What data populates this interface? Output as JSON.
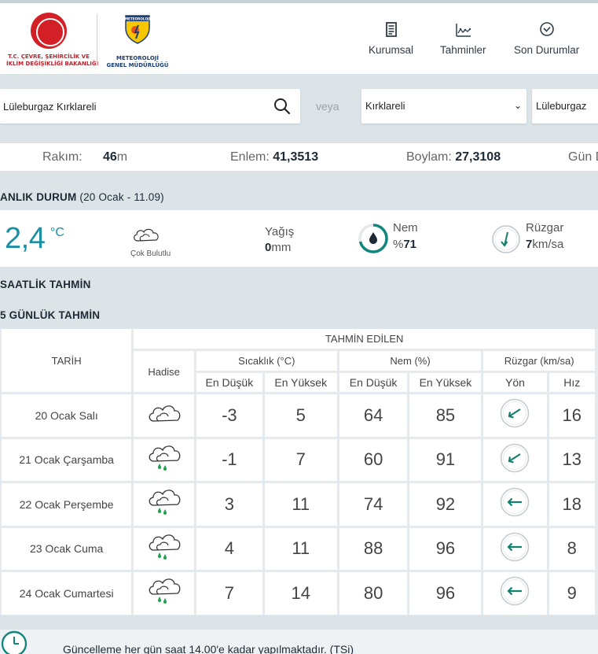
{
  "header": {
    "logo1_line1": "T.C. ÇEVRE, ŞEHİRCİLİK VE",
    "logo1_line2": "İKLİM DEĞİŞİKLİĞİ BAKANLIĞI",
    "logo2_badge": "METEOROLOJİ",
    "logo2_line1": "METEOROLOJİ",
    "logo2_line2": "GENEL MÜDÜRLÜĞÜ",
    "nav": [
      {
        "label": "Kurumsal",
        "icon": "document-icon"
      },
      {
        "label": "Tahminler",
        "icon": "chart-icon"
      },
      {
        "label": "Son Durumlar",
        "icon": "check-circle-icon"
      }
    ]
  },
  "search": {
    "value": "Lüleburgaz Kırklareli",
    "or_label": "veya",
    "province": "Kırklareli",
    "district": "Lüleburgaz"
  },
  "info": {
    "altitude_label": "Rakım:",
    "altitude_value": "46",
    "altitude_unit": "m",
    "lat_label": "Enlem:",
    "lat_value": "41,3513",
    "lon_label": "Boylam:",
    "lon_value": "27,3108",
    "extra_label": "Gün D"
  },
  "current": {
    "title": "ANLIK DURUM",
    "time": "(20 Ocak - 11.09)",
    "temp": "2,4",
    "temp_unit": "°C",
    "condition": "Çok Bulutlu",
    "rain_label": "Yağış",
    "rain_value": "0",
    "rain_unit": "mm",
    "humidity_label": "Nem",
    "humidity_prefix": "%",
    "humidity_value": "71",
    "humidity_fraction": 0.71,
    "wind_label": "Rüzgar",
    "wind_value": "7",
    "wind_unit": "km/sa"
  },
  "sections": {
    "hourly": "SAATLİK TAHMİN",
    "five_day": "5 GÜNLÜK TAHMİN"
  },
  "forecast": {
    "date_header": "TARİH",
    "estimated_header": "TAHMİN EDİLEN",
    "event_header": "Hadise",
    "temp_header": "Sıcaklık (°C)",
    "humidity_header": "Nem (%)",
    "wind_header": "Rüzgar (km/sa)",
    "low_label": "En Düşük",
    "high_label": "En Yüksek",
    "dir_label": "Yön",
    "speed_label": "Hız",
    "rows": [
      {
        "date": "20 Ocak Salı",
        "icon": "cloud-icon",
        "tmin": "-3",
        "tmax": "5",
        "hmin": "64",
        "hmax": "85",
        "wind_dir": "arrow-down-left-icon",
        "wind_speed": "16"
      },
      {
        "date": "21 Ocak Çarşamba",
        "icon": "cloud-rain-icon",
        "tmin": "-1",
        "tmax": "7",
        "hmin": "60",
        "hmax": "91",
        "wind_dir": "arrow-down-left-icon",
        "wind_speed": "13"
      },
      {
        "date": "22 Ocak Perşembe",
        "icon": "cloud-rain-icon",
        "tmin": "3",
        "tmax": "11",
        "hmin": "74",
        "hmax": "92",
        "wind_dir": "arrow-left-icon",
        "wind_speed": "18"
      },
      {
        "date": "23 Ocak Cuma",
        "icon": "cloud-rain-icon",
        "tmin": "4",
        "tmax": "11",
        "hmin": "88",
        "hmax": "96",
        "wind_dir": "arrow-left-icon",
        "wind_speed": "8"
      },
      {
        "date": "24 Ocak Cumartesi",
        "icon": "cloud-rain-icon",
        "tmin": "7",
        "tmax": "14",
        "hmin": "80",
        "hmax": "96",
        "wind_dir": "arrow-left-icon",
        "wind_speed": "9"
      }
    ]
  },
  "footer": {
    "text": "Güncelleme her gün saat 14.00'e kadar yapılmaktadır. (TSi)"
  },
  "colors": {
    "accent_teal": "#1d8fa5",
    "low_temp": "#1f6e8c",
    "high_temp": "#c21f3a",
    "low_humidity": "#d18b00",
    "high_humidity": "#3d3d6b",
    "wind_speed": "#13867b",
    "arrow": "#12806f"
  }
}
